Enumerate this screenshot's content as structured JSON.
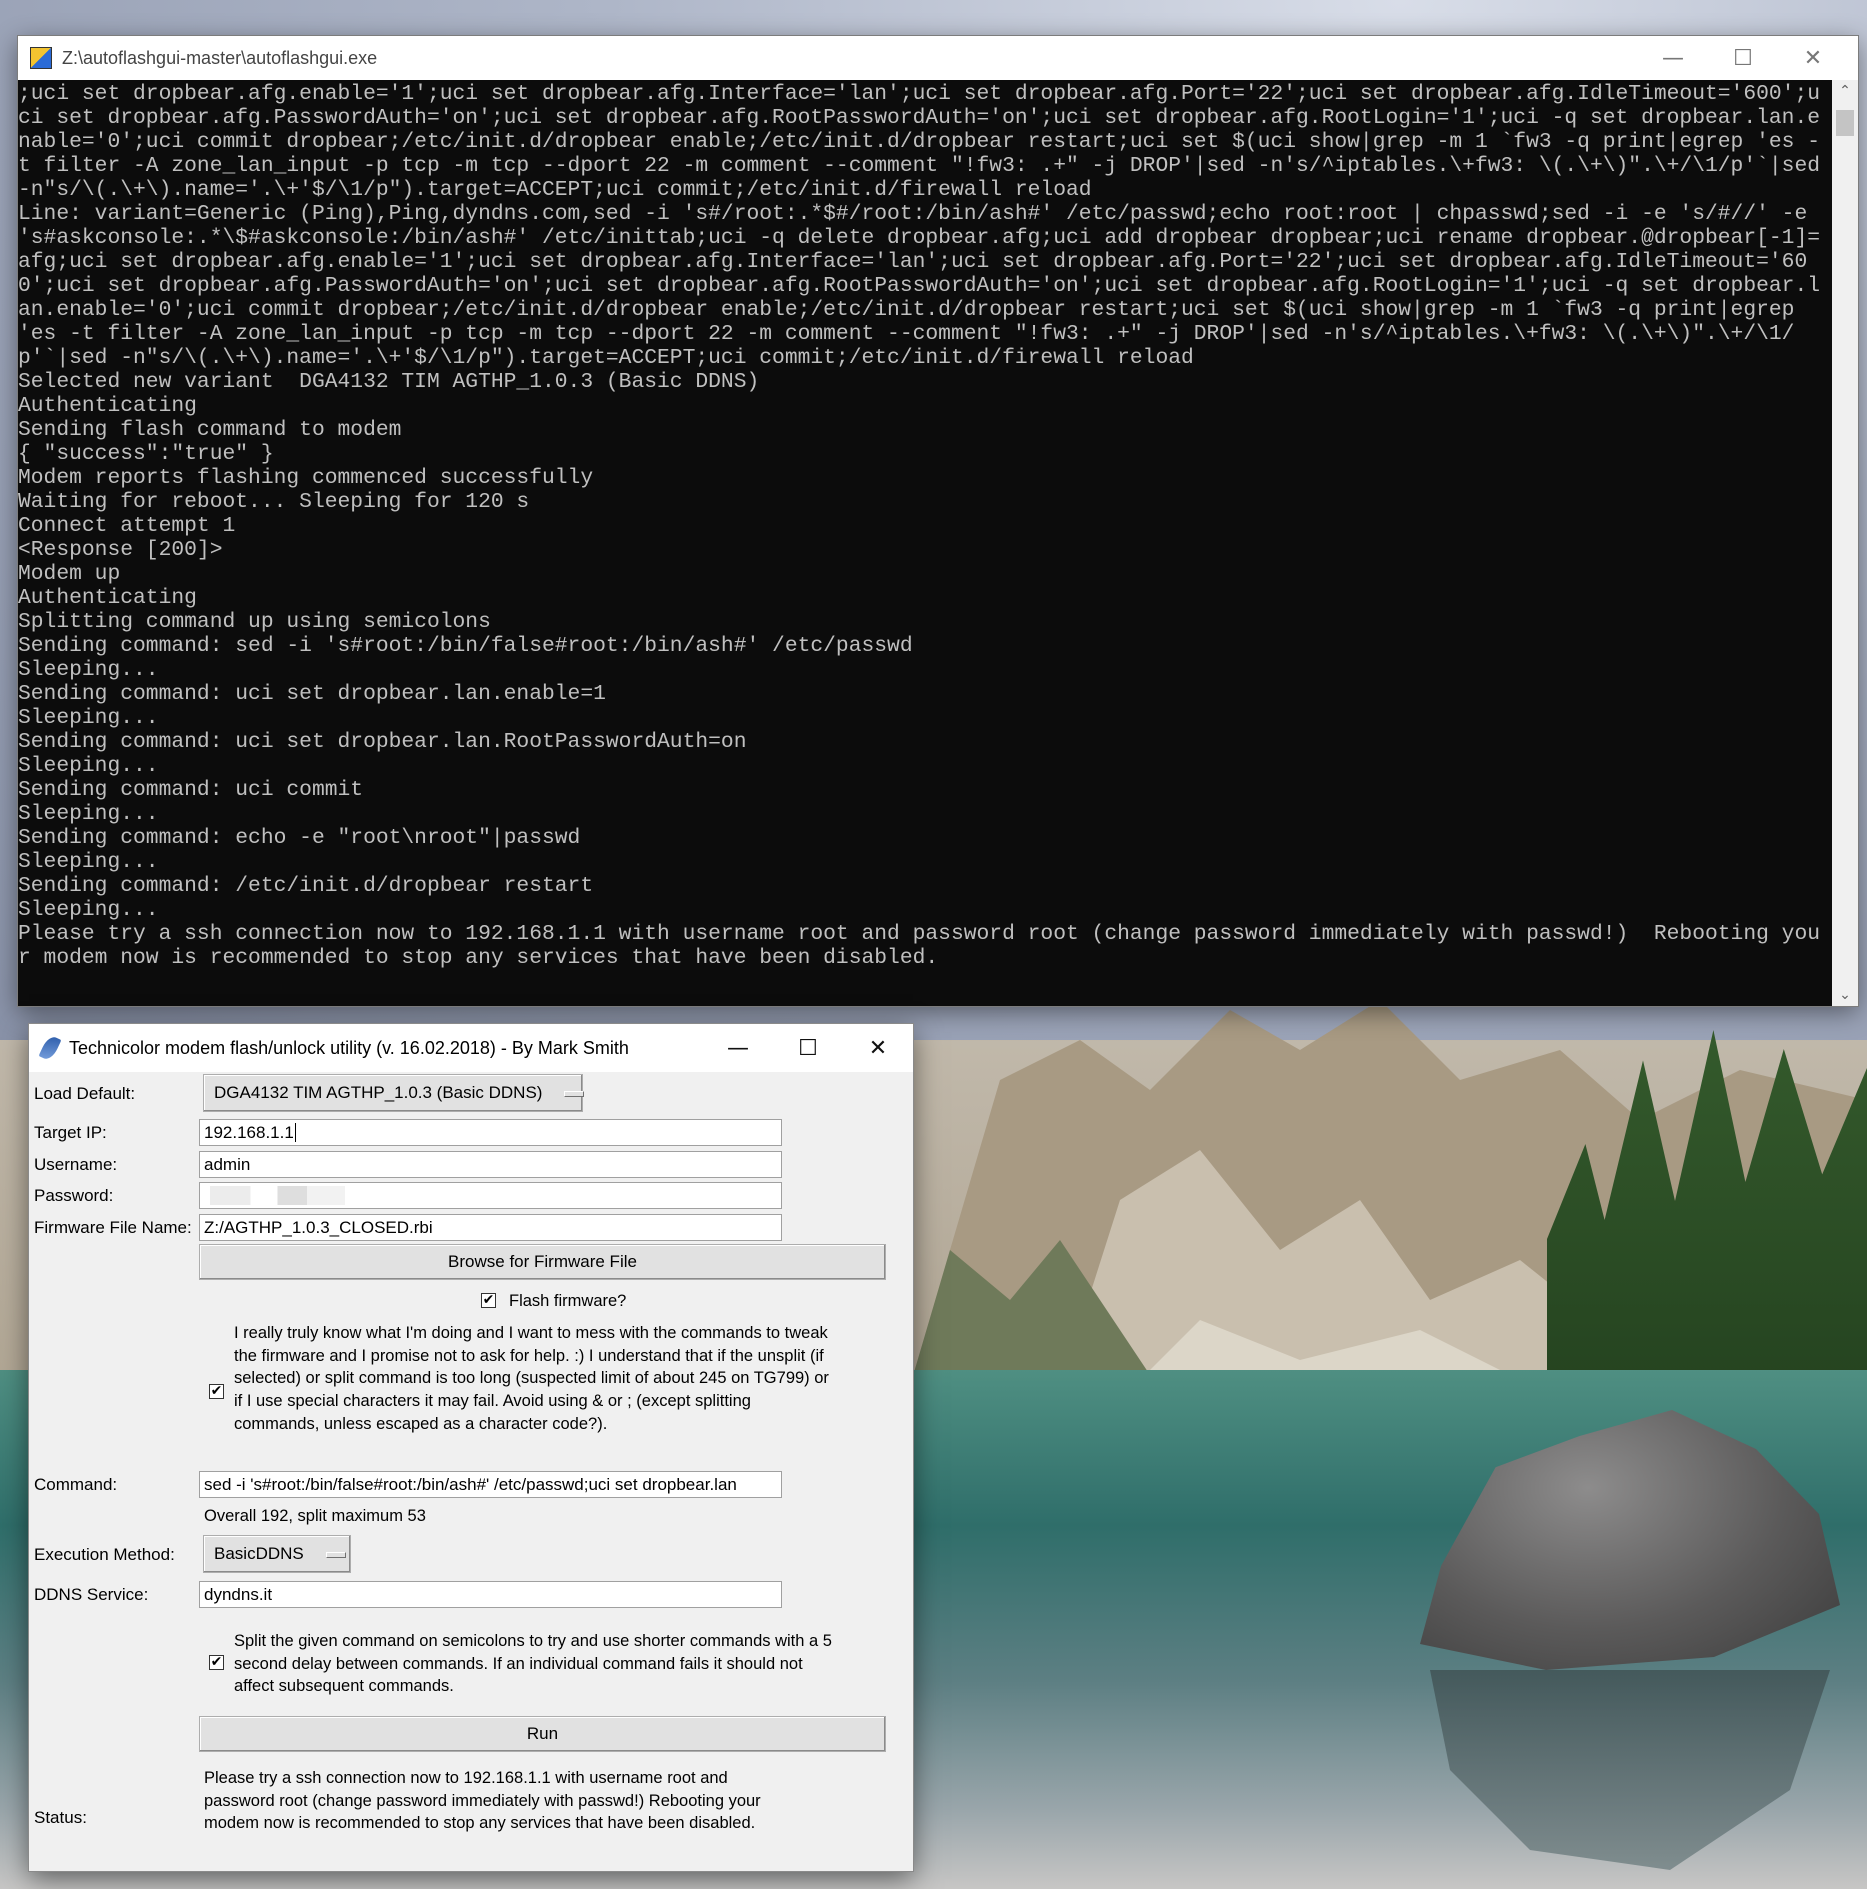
{
  "console": {
    "title": "Z:\\autoflashgui-master\\autoflashgui.exe",
    "minimize": "—",
    "maximize": "☐",
    "close": "✕",
    "scroll_up": "⌃",
    "scroll_down": "⌄",
    "output": ";uci set dropbear.afg.enable='1';uci set dropbear.afg.Interface='lan';uci set dropbear.afg.Port='22';uci set dropbear.afg.IdleTimeout='600';uci set dropbear.afg.PasswordAuth='on';uci set dropbear.afg.RootPasswordAuth='on';uci set dropbear.afg.RootLogin='1';uci -q set dropbear.lan.enable='0';uci commit dropbear;/etc/init.d/dropbear enable;/etc/init.d/dropbear restart;uci set $(uci show|grep -m 1 `fw3 -q print|egrep 'es -t filter -A zone_lan_input -p tcp -m tcp --dport 22 -m comment --comment \"!fw3: .+\" -j DROP'|sed -n's/^iptables.\\+fw3: \\(.\\+\\)\".\\+/\\1/p'`|sed -n\"s/\\(.\\+\\).name='.\\+'$/\\1/p\").target=ACCEPT;uci commit;/etc/init.d/firewall reload\nLine: variant=Generic (Ping),Ping,dyndns.com,sed -i 's#/root:.*$#/root:/bin/ash#' /etc/passwd;echo root:root | chpasswd;sed -i -e 's/#//' -e 's#askconsole:.*\\$#askconsole:/bin/ash#' /etc/inittab;uci -q delete dropbear.afg;uci add dropbear dropbear;uci rename dropbear.@dropbear[-1]=afg;uci set dropbear.afg.enable='1';uci set dropbear.afg.Interface='lan';uci set dropbear.afg.Port='22';uci set dropbear.afg.IdleTimeout='600';uci set dropbear.afg.PasswordAuth='on';uci set dropbear.afg.RootPasswordAuth='on';uci set dropbear.afg.RootLogin='1';uci -q set dropbear.lan.enable='0';uci commit dropbear;/etc/init.d/dropbear enable;/etc/init.d/dropbear restart;uci set $(uci show|grep -m 1 `fw3 -q print|egrep 'es -t filter -A zone_lan_input -p tcp -m tcp --dport 22 -m comment --comment \"!fw3: .+\" -j DROP'|sed -n's/^iptables.\\+fw3: \\(.\\+\\)\".\\+/\\1/p'`|sed -n\"s/\\(.\\+\\).name='.\\+'$/\\1/p\").target=ACCEPT;uci commit;/etc/init.d/firewall reload\nSelected new variant  DGA4132 TIM AGTHP_1.0.3 (Basic DDNS)\nAuthenticating\nSending flash command to modem\n{ \"success\":\"true\" }\nModem reports flashing commenced successfully\nWaiting for reboot... Sleeping for 120 s\nConnect attempt 1\n<Response [200]>\nModem up\nAuthenticating\nSplitting command up using semicolons\nSending command: sed -i 's#root:/bin/false#root:/bin/ash#' /etc/passwd\nSleeping...\nSending command: uci set dropbear.lan.enable=1\nSleeping...\nSending command: uci set dropbear.lan.RootPasswordAuth=on\nSleeping...\nSending command: uci commit\nSleeping...\nSending command: echo -e \"root\\nroot\"|passwd\nSleeping...\nSending command: /etc/init.d/dropbear restart\nSleeping...\nPlease try a ssh connection now to 192.168.1.1 with username root and password root (change password immediately with passwd!)  Rebooting your modem now is recommended to stop any services that have been disabled."
  },
  "utility": {
    "title": "Technicolor modem flash/unlock utility (v. 16.02.2018) - By Mark Smith",
    "minimize": "—",
    "maximize": "☐",
    "close": "✕",
    "labels": {
      "load_default": "Load Default:",
      "target_ip": "Target IP:",
      "username": "Username:",
      "password": "Password:",
      "firmware_file": "Firmware File Name:",
      "command": "Command:",
      "execution_method": "Execution Method:",
      "ddns_service": "DDNS Service:",
      "status": "Status:"
    },
    "load_default_value": "DGA4132 TIM AGTHP_1.0.3 (Basic DDNS)",
    "target_ip_value": "192.168.1.1",
    "username_value": "admin",
    "password_value": "",
    "firmware_file_value": "Z:/AGTHP_1.0.3_CLOSED.rbi",
    "browse_button": "Browse for Firmware File",
    "flash_checkbox": {
      "checked": true,
      "mark": "✔",
      "label": "Flash firmware?"
    },
    "expert_checkbox": {
      "checked": true,
      "mark": "✔",
      "label": "I really truly know what I'm doing and I want to mess with the commands to tweak the firmware and I promise not to ask for help. :)  I understand that if the unsplit (if selected) or split command is too long (suspected limit of about 245 on TG799) or if I use special characters it may fail.  Avoid using & or ; (except splitting commands, unless escaped as a character code?)."
    },
    "command_value": "sed -i 's#root:/bin/false#root:/bin/ash#' /etc/passwd;uci set dropbear.lan",
    "command_length_info": "Overall 192, split maximum 53",
    "execution_method_value": "BasicDDNS",
    "ddns_service_value": "dyndns.it",
    "split_checkbox": {
      "checked": true,
      "mark": "✔",
      "label": "Split the given command on semicolons to try and use shorter commands with a 5 second delay between commands.  If an individual command fails it should not affect subsequent commands."
    },
    "run_button": "Run",
    "status_text": "Please try a ssh connection now to 192.168.1.1 with username root and password root (change password immediately with passwd!)  Rebooting your modem now is recommended to stop any services that have been disabled."
  }
}
